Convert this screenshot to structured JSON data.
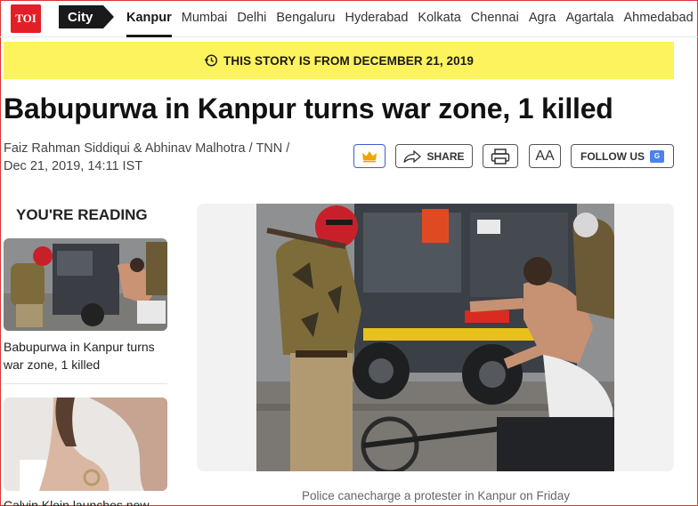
{
  "nav": {
    "logo": "TOI",
    "section": "City",
    "cities": [
      "Kanpur",
      "Mumbai",
      "Delhi",
      "Bengaluru",
      "Hyderabad",
      "Kolkata",
      "Chennai",
      "Agra",
      "Agartala",
      "Ahmedabad"
    ],
    "active_city": "Kanpur"
  },
  "banner": {
    "text": "THIS STORY IS FROM DECEMBER 21, 2019"
  },
  "article": {
    "title": "Babupurwa in Kanpur turns war zone, 1 killed",
    "byline_authors": "Faiz Rahman Siddiqui & Abhinav Malhotra / TNN /",
    "byline_date": "Dec 21, 2019, 14:11 IST",
    "caption": "Police canecharge a protester in Kanpur on Friday"
  },
  "actions": {
    "share_label": "SHARE",
    "aa_label": "AA",
    "follow_label": "FOLLOW US",
    "gnews_label": "G"
  },
  "sidebar": {
    "heading": "YOU'RE READING",
    "items": [
      {
        "title": "Babupurwa in Kanpur turns war zone, 1 killed"
      },
      {
        "title": "Calvin Klein launches new"
      }
    ]
  },
  "colors": {
    "brand_red": "#e21f26",
    "banner_yellow": "#fdf35d",
    "accent_blue": "#3b5fd0"
  }
}
